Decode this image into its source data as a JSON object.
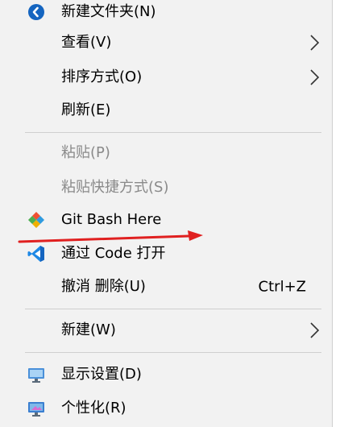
{
  "menu": {
    "items": [
      {
        "label": "新建文件夹(N)",
        "icon": "new-folder-icon"
      },
      {
        "label": "查看(V)",
        "submenu": true
      },
      {
        "label": "排序方式(O)",
        "submenu": true
      },
      {
        "label": "刷新(E)"
      },
      {
        "label": "粘贴(P)",
        "disabled": true
      },
      {
        "label": "粘贴快捷方式(S)",
        "disabled": true
      },
      {
        "label": "Git Bash Here",
        "icon": "git-icon"
      },
      {
        "label": "通过 Code 打开",
        "icon": "vscode-icon"
      },
      {
        "label": "撤消 删除(U)",
        "shortcut": "Ctrl+Z"
      },
      {
        "label": "新建(W)",
        "submenu": true
      },
      {
        "label": "显示设置(D)",
        "icon": "display-settings-icon"
      },
      {
        "label": "个性化(R)",
        "icon": "personalize-icon"
      }
    ]
  },
  "colors": {
    "menu_bg": "#f2f2f2",
    "disabled_text": "#8a8a8a",
    "separator": "#cfcfcf",
    "annotation_arrow": "#e02020",
    "vscode_blue": "#1e88e5",
    "new_folder_blue": "#1565c0"
  }
}
